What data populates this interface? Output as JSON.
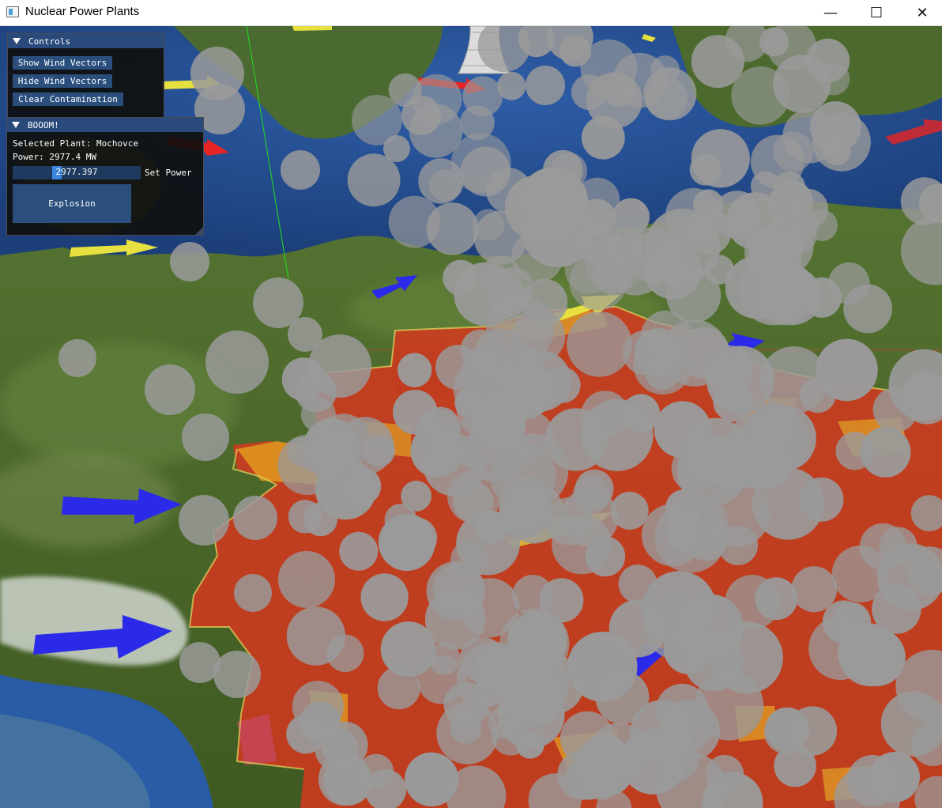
{
  "window": {
    "title": "Nuclear Power Plants",
    "minimize_icon": "minimize-icon",
    "maximize_icon": "maximize-icon",
    "close_icon": "close-icon"
  },
  "controls_panel": {
    "title": "Controls",
    "buttons": {
      "show_wind": "Show Wind Vectors",
      "hide_wind": "Hide Wind Vectors",
      "clear_contamination": "Clear Contamination"
    }
  },
  "boom_panel": {
    "title": "BOOOM!",
    "selected_plant": "Selected Plant: Mochovce",
    "power": "Power: 2977.4 MW",
    "power_input_value": "2977.397",
    "set_power_label": "Set Power",
    "explosion_button": "Explosion"
  },
  "colors": {
    "panel_header": "#294a7a",
    "button": "#2a4f7d",
    "contamination_high": "#d23a22",
    "contamination_medium": "#e0a020",
    "wind_arrow_red": "#e82424",
    "wind_arrow_blue": "#2a2ae8",
    "wind_arrow_yellow": "#e6e040",
    "smoke": "#9a9a9a"
  }
}
